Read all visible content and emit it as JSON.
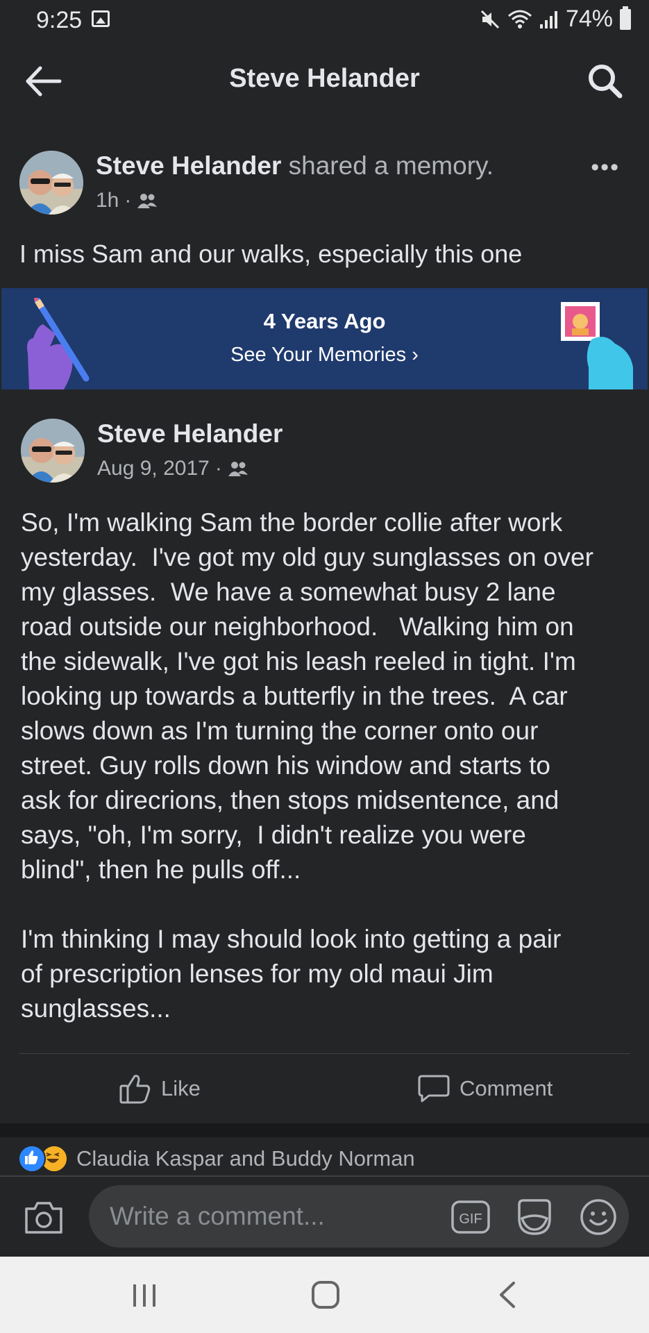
{
  "status_bar": {
    "time": "9:25",
    "battery": "74%"
  },
  "header": {
    "title": "Steve Helander"
  },
  "post": {
    "author": "Steve Helander",
    "action": "shared a memory.",
    "time": "1h",
    "caption": "I miss Sam and our walks, especially this one"
  },
  "memories_banner": {
    "title": "4 Years Ago",
    "link": "See Your Memories"
  },
  "memory_post": {
    "author": "Steve Helander",
    "date": "Aug 9, 2017",
    "text": "So, I'm walking Sam the border collie after work\nyesterday.  I've got my old guy sunglasses on over\nmy glasses.  We have a somewhat busy 2 lane\nroad outside our neighborhood.   Walking him on\nthe sidewalk, I've got his leash reeled in tight. I'm\nlooking up towards a butterfly in the trees.  A car\nslows down as I'm turning the corner onto our\nstreet. Guy rolls down his window and starts to\nask for direcrions, then stops midsentence, and\nsays, \"oh, I'm sorry,  I didn't realize you were\nblind\", then he pulls off...\n\nI'm thinking I may should look into getting a pair\nof prescription lenses for my old maui Jim\nsunglasses..."
  },
  "actions": {
    "like": "Like",
    "comment": "Comment"
  },
  "reactions": {
    "names": "Claudia Kaspar and Buddy Norman"
  },
  "comment_box": {
    "placeholder": "Write a comment...",
    "gif_label": "GIF"
  },
  "icons": [
    "back-arrow-icon",
    "search-icon",
    "more-icon",
    "friends-icon",
    "like-icon",
    "comment-icon",
    "camera-icon",
    "gif-icon",
    "sticker-icon",
    "emoji-icon",
    "recent-apps-icon",
    "home-icon",
    "back-nav-icon"
  ],
  "colors": {
    "background": "#242526",
    "banner": "#1f3a6d",
    "like_blue": "#2d88ff",
    "haha_yellow": "#f7b125"
  }
}
